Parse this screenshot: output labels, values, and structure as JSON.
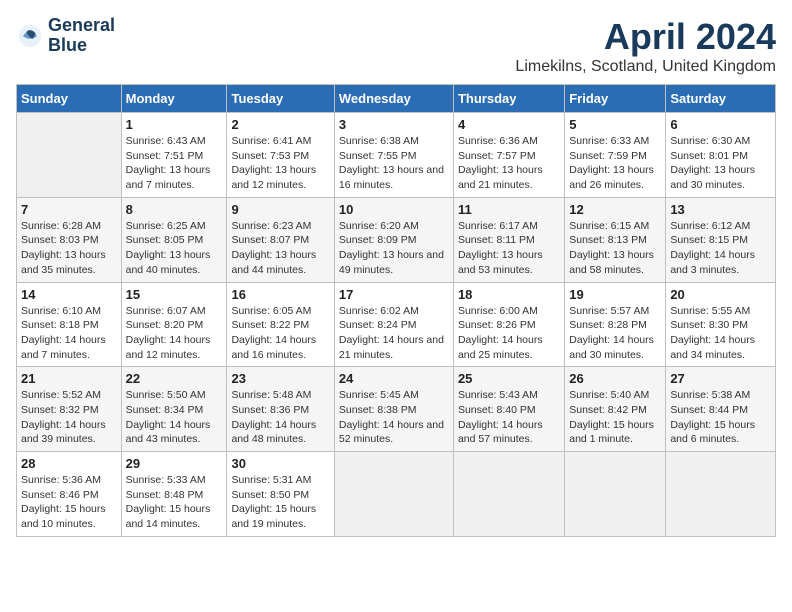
{
  "header": {
    "logo_line1": "General",
    "logo_line2": "Blue",
    "main_title": "April 2024",
    "subtitle": "Limekilns, Scotland, United Kingdom"
  },
  "days_of_week": [
    "Sunday",
    "Monday",
    "Tuesday",
    "Wednesday",
    "Thursday",
    "Friday",
    "Saturday"
  ],
  "weeks": [
    [
      {
        "day": "",
        "empty": true
      },
      {
        "day": "1",
        "sunrise": "6:43 AM",
        "sunset": "7:51 PM",
        "daylight": "13 hours and 7 minutes."
      },
      {
        "day": "2",
        "sunrise": "6:41 AM",
        "sunset": "7:53 PM",
        "daylight": "13 hours and 12 minutes."
      },
      {
        "day": "3",
        "sunrise": "6:38 AM",
        "sunset": "7:55 PM",
        "daylight": "13 hours and 16 minutes."
      },
      {
        "day": "4",
        "sunrise": "6:36 AM",
        "sunset": "7:57 PM",
        "daylight": "13 hours and 21 minutes."
      },
      {
        "day": "5",
        "sunrise": "6:33 AM",
        "sunset": "7:59 PM",
        "daylight": "13 hours and 26 minutes."
      },
      {
        "day": "6",
        "sunrise": "6:30 AM",
        "sunset": "8:01 PM",
        "daylight": "13 hours and 30 minutes."
      }
    ],
    [
      {
        "day": "7",
        "sunrise": "6:28 AM",
        "sunset": "8:03 PM",
        "daylight": "13 hours and 35 minutes."
      },
      {
        "day": "8",
        "sunrise": "6:25 AM",
        "sunset": "8:05 PM",
        "daylight": "13 hours and 40 minutes."
      },
      {
        "day": "9",
        "sunrise": "6:23 AM",
        "sunset": "8:07 PM",
        "daylight": "13 hours and 44 minutes."
      },
      {
        "day": "10",
        "sunrise": "6:20 AM",
        "sunset": "8:09 PM",
        "daylight": "13 hours and 49 minutes."
      },
      {
        "day": "11",
        "sunrise": "6:17 AM",
        "sunset": "8:11 PM",
        "daylight": "13 hours and 53 minutes."
      },
      {
        "day": "12",
        "sunrise": "6:15 AM",
        "sunset": "8:13 PM",
        "daylight": "13 hours and 58 minutes."
      },
      {
        "day": "13",
        "sunrise": "6:12 AM",
        "sunset": "8:15 PM",
        "daylight": "14 hours and 3 minutes."
      }
    ],
    [
      {
        "day": "14",
        "sunrise": "6:10 AM",
        "sunset": "8:18 PM",
        "daylight": "14 hours and 7 minutes."
      },
      {
        "day": "15",
        "sunrise": "6:07 AM",
        "sunset": "8:20 PM",
        "daylight": "14 hours and 12 minutes."
      },
      {
        "day": "16",
        "sunrise": "6:05 AM",
        "sunset": "8:22 PM",
        "daylight": "14 hours and 16 minutes."
      },
      {
        "day": "17",
        "sunrise": "6:02 AM",
        "sunset": "8:24 PM",
        "daylight": "14 hours and 21 minutes."
      },
      {
        "day": "18",
        "sunrise": "6:00 AM",
        "sunset": "8:26 PM",
        "daylight": "14 hours and 25 minutes."
      },
      {
        "day": "19",
        "sunrise": "5:57 AM",
        "sunset": "8:28 PM",
        "daylight": "14 hours and 30 minutes."
      },
      {
        "day": "20",
        "sunrise": "5:55 AM",
        "sunset": "8:30 PM",
        "daylight": "14 hours and 34 minutes."
      }
    ],
    [
      {
        "day": "21",
        "sunrise": "5:52 AM",
        "sunset": "8:32 PM",
        "daylight": "14 hours and 39 minutes."
      },
      {
        "day": "22",
        "sunrise": "5:50 AM",
        "sunset": "8:34 PM",
        "daylight": "14 hours and 43 minutes."
      },
      {
        "day": "23",
        "sunrise": "5:48 AM",
        "sunset": "8:36 PM",
        "daylight": "14 hours and 48 minutes."
      },
      {
        "day": "24",
        "sunrise": "5:45 AM",
        "sunset": "8:38 PM",
        "daylight": "14 hours and 52 minutes."
      },
      {
        "day": "25",
        "sunrise": "5:43 AM",
        "sunset": "8:40 PM",
        "daylight": "14 hours and 57 minutes."
      },
      {
        "day": "26",
        "sunrise": "5:40 AM",
        "sunset": "8:42 PM",
        "daylight": "15 hours and 1 minute."
      },
      {
        "day": "27",
        "sunrise": "5:38 AM",
        "sunset": "8:44 PM",
        "daylight": "15 hours and 6 minutes."
      }
    ],
    [
      {
        "day": "28",
        "sunrise": "5:36 AM",
        "sunset": "8:46 PM",
        "daylight": "15 hours and 10 minutes."
      },
      {
        "day": "29",
        "sunrise": "5:33 AM",
        "sunset": "8:48 PM",
        "daylight": "15 hours and 14 minutes."
      },
      {
        "day": "30",
        "sunrise": "5:31 AM",
        "sunset": "8:50 PM",
        "daylight": "15 hours and 19 minutes."
      },
      {
        "day": "",
        "empty": true
      },
      {
        "day": "",
        "empty": true
      },
      {
        "day": "",
        "empty": true
      },
      {
        "day": "",
        "empty": true
      }
    ]
  ],
  "labels": {
    "sunrise": "Sunrise:",
    "sunset": "Sunset:",
    "daylight": "Daylight:"
  }
}
